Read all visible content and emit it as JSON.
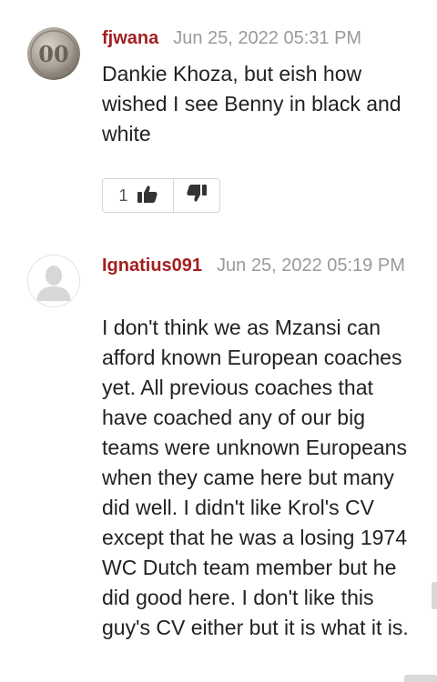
{
  "comments": [
    {
      "author": "fjwana",
      "date": "Jun 25, 2022 05:31 PM",
      "text": "Dankie Khoza, but eish how wished I see Benny in black and white",
      "upvotes": "1",
      "avatar_icon": "coin-avatar-icon"
    },
    {
      "author": "Ignatius091",
      "date": "Jun 25, 2022 05:19 PM",
      "text": "I don't think we as Mzansi can afford known European coaches yet. All previous coaches that have coached any of our big teams were unknown Europeans when they came here but many did well. I didn't like Krol's CV except that he was a losing 1974 WC Dutch team member but he did good here. I don't like this guy's CV either but it is what it is.",
      "avatar_icon": "default-user-avatar-icon"
    }
  ],
  "colors": {
    "author": "#a31f1f",
    "date": "#9a9a9a",
    "text": "#222222",
    "vote_icon": "#333333"
  }
}
